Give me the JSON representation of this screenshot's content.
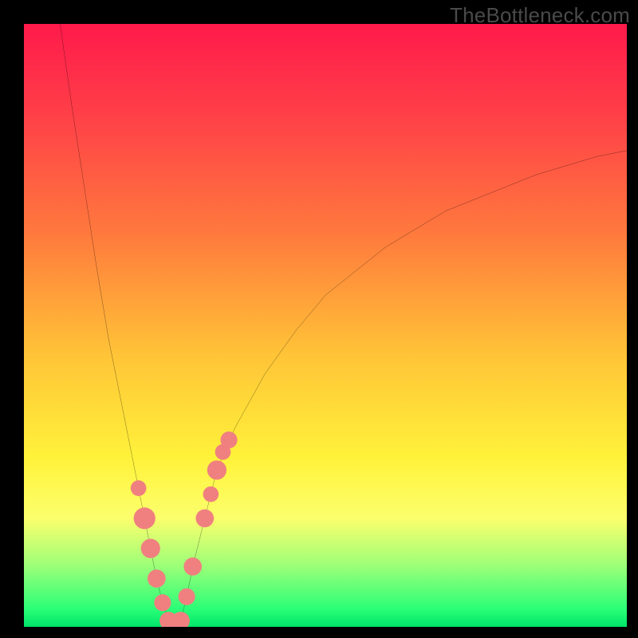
{
  "attribution": "TheBottleneck.com",
  "colors": {
    "gradient_top": "#ff1a4b",
    "gradient_mid_orange": "#ff7a3d",
    "gradient_yellow": "#fff23a",
    "gradient_green": "#00e56a",
    "curve": "#000000",
    "markers": "#f08080",
    "frame": "#000000"
  },
  "chart_data": {
    "type": "line",
    "title": "",
    "xlabel": "",
    "ylabel": "",
    "xlim": [
      0,
      100
    ],
    "ylim": [
      0,
      100
    ],
    "x": [
      6,
      8,
      10,
      12,
      14,
      16,
      18,
      19,
      20,
      21,
      22,
      23,
      24,
      25,
      26,
      27,
      28,
      30,
      32,
      35,
      40,
      45,
      50,
      55,
      60,
      65,
      70,
      75,
      80,
      85,
      90,
      95,
      100
    ],
    "values": [
      100,
      86,
      73,
      60,
      48,
      38,
      28,
      23,
      18,
      13,
      8,
      4,
      1,
      0,
      1,
      5,
      10,
      18,
      26,
      33,
      42,
      49,
      55,
      59,
      63,
      66,
      69,
      71,
      73,
      75,
      76.5,
      78,
      79
    ],
    "series": [
      {
        "name": "bottleneck-curve",
        "x": [
          6,
          8,
          10,
          12,
          14,
          16,
          18,
          19,
          20,
          21,
          22,
          23,
          24,
          25,
          26,
          27,
          28,
          30,
          32,
          35,
          40,
          45,
          50,
          55,
          60,
          65,
          70,
          75,
          80,
          85,
          90,
          95,
          100
        ],
        "values": [
          100,
          86,
          73,
          60,
          48,
          38,
          28,
          23,
          18,
          13,
          8,
          4,
          1,
          0,
          1,
          5,
          10,
          18,
          26,
          33,
          42,
          49,
          55,
          59,
          63,
          66,
          69,
          71,
          73,
          75,
          76.5,
          78,
          79
        ]
      }
    ],
    "markers": [
      {
        "name": "marker",
        "x": 19,
        "y": 23,
        "r": 1.3
      },
      {
        "name": "marker",
        "x": 20,
        "y": 18,
        "r": 1.8
      },
      {
        "name": "marker",
        "x": 21,
        "y": 13,
        "r": 1.6
      },
      {
        "name": "marker",
        "x": 22,
        "y": 8,
        "r": 1.5
      },
      {
        "name": "marker",
        "x": 23,
        "y": 4,
        "r": 1.4
      },
      {
        "name": "marker",
        "x": 24,
        "y": 1,
        "r": 1.5
      },
      {
        "name": "marker",
        "x": 25,
        "y": 0,
        "r": 1.6
      },
      {
        "name": "marker",
        "x": 26,
        "y": 1,
        "r": 1.5
      },
      {
        "name": "marker",
        "x": 27,
        "y": 5,
        "r": 1.4
      },
      {
        "name": "marker",
        "x": 28,
        "y": 10,
        "r": 1.5
      },
      {
        "name": "marker",
        "x": 30,
        "y": 18,
        "r": 1.5
      },
      {
        "name": "marker",
        "x": 31,
        "y": 22,
        "r": 1.3
      },
      {
        "name": "marker",
        "x": 32,
        "y": 26,
        "r": 1.6
      },
      {
        "name": "marker",
        "x": 33,
        "y": 29,
        "r": 1.3
      },
      {
        "name": "marker",
        "x": 34,
        "y": 31,
        "r": 1.4
      }
    ]
  }
}
